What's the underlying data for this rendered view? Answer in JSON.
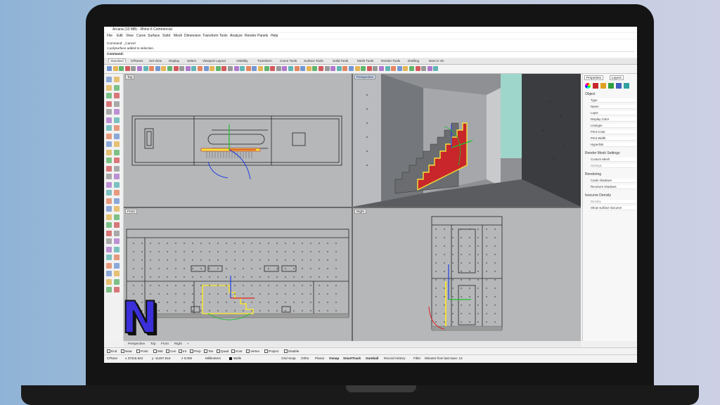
{
  "window": {
    "title": "Arcana (10 MB) - Rhino 6 Commercial"
  },
  "menu": [
    "File",
    "Edit",
    "View",
    "Curve",
    "Surface",
    "Solid",
    "Mesh",
    "Dimension",
    "Transform",
    "Tools",
    "Analyze",
    "Render",
    "Panels",
    "Help"
  ],
  "command_history": [
    "Command: _Cancel",
    "1 polysurface added to selection.",
    "Command:"
  ],
  "toolbar_tabs": [
    "Standard",
    "CPlanes",
    "Set View",
    "Display",
    "Select",
    "Viewport Layout",
    "Visibility",
    "Transform",
    "Curve Tools",
    "Surface Tools",
    "Solid Tools",
    "Mesh Tools",
    "Render Tools",
    "Drafting",
    "New in V6"
  ],
  "viewports": {
    "top": "Top",
    "perspective": "Perspective",
    "front": "Front",
    "right": "Right"
  },
  "viewport_tabs": [
    "Perspective",
    "Top",
    "Front",
    "Right"
  ],
  "viewport_tab_add": "+",
  "osnaps": [
    "End",
    "Near",
    "Point",
    "Mid",
    "Cen",
    "Int",
    "Perp",
    "Tan",
    "Quad",
    "Knot",
    "Vertex",
    "Project",
    "Disable"
  ],
  "status": {
    "cplane": "CPlane",
    "x": "x 37315.842",
    "y": "y -11267.816",
    "z": "z 0.000",
    "units": "Millimeters",
    "layer": "Walls",
    "grid_snap": "Grid Snap",
    "ortho": "Ortho",
    "planar": "Planar",
    "osnap": "Osnap",
    "smarttrack": "SmartTrack",
    "gumball": "Gumball",
    "record_history": "Record History",
    "filter": "Filter",
    "save_info": "Minutes from last save: 13"
  },
  "panel": {
    "tabs": [
      "Properties",
      "Layers"
    ],
    "object_header": "Object",
    "object_fields": [
      "Type",
      "Name",
      "Layer",
      "Display Color",
      "Linetype",
      "Print Color",
      "Print Width",
      "Hyperlink"
    ],
    "render_mesh_header": "Render Mesh Settings",
    "render_mesh_fields": [
      "Custom Mesh",
      "Settings"
    ],
    "rendering_header": "Rendering",
    "rendering_fields": [
      "Casts shadows",
      "Receives shadows"
    ],
    "isocurve_header": "Isocurve Density",
    "isocurve_fields": [
      "Density",
      "Show surface isocurve"
    ]
  },
  "logo": {
    "letter": "N",
    "color": "#3a2fd8"
  },
  "colors": {
    "selection": "#f2e23a",
    "red_surface": "#c8262a",
    "gumball_x": "#e02020",
    "gumball_y": "#20c030",
    "gumball_z": "#2040e0"
  }
}
